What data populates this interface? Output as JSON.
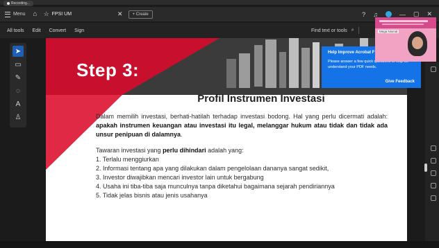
{
  "recording": {
    "label": "Recording..."
  },
  "titlebar": {
    "menu_label": "Menu",
    "tab_title": "FPSI UM",
    "create_label": "Create",
    "icons": [
      "help-icon",
      "bell-icon",
      "minimize-icon",
      "restore-icon",
      "close-icon"
    ]
  },
  "menubar": {
    "items": [
      "All tools",
      "Edit",
      "Convert",
      "Sign"
    ],
    "find_label": "Find text or tools"
  },
  "document": {
    "step_label": "Step 3:",
    "title": "Profil Instrumen Investasi",
    "para1_normal": "Dalam memilih investasi, berhati-hatilah terhadap investasi bodong. Hal yang perlu dicermati adalah: ",
    "para1_bold": "apakah instrumen keuangan atau investasi itu legal, melanggar hukum atau tidak dan tidak ada unsur penipuan di dalamnya",
    "para1_end": ".",
    "para2_normal": "Tawaran investasi yang ",
    "para2_bold": "perlu dihindari",
    "para2_end": " adalah yang:",
    "list": [
      "1. Terlalu menggiurkan",
      "2. Informasi tentang apa yang dilakukan dalam pengelolaan dananya sangat sedikit,",
      "3. Investor diwajibkan mencari investor lain untuk bergabung",
      "4. Usaha ini tiba-tiba saja munculnya tanpa diketahui bagaimana sejarah pendiriannya",
      "5. Tidak jelas bisnis atau jenis usahanya"
    ]
  },
  "popup": {
    "heading": "Help Improve Acrobat F",
    "body": "Please answer a few quick questions to help us understand your PDF needs.",
    "button": "Give Feedback"
  },
  "webcam": {
    "name": "Mega Nismal"
  },
  "colors": {
    "accent_red": "#c8102e",
    "popup_blue": "#1473e6",
    "tool_active": "#1f5fb3"
  }
}
